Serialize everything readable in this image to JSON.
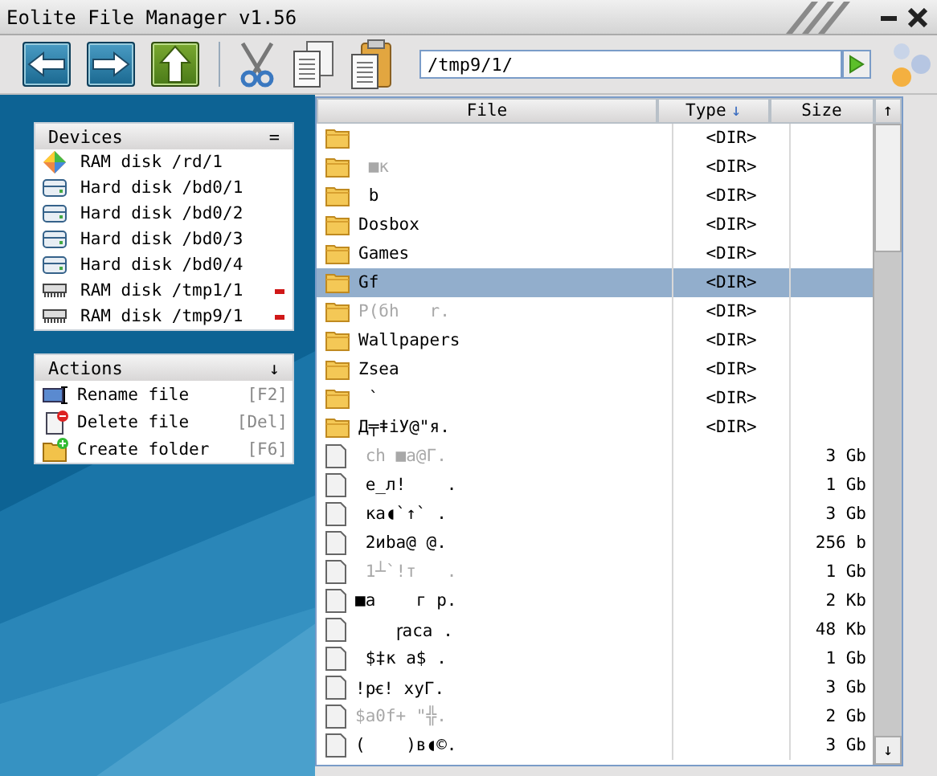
{
  "window": {
    "title": "Eolite File Manager v1.56"
  },
  "toolbar": {
    "path": "/tmp9/1/"
  },
  "devices": {
    "title": "Devices",
    "menu": "=",
    "items": [
      {
        "kind": "ramdisk",
        "label": "RAM disk /rd/1",
        "removable": false
      },
      {
        "kind": "hdd",
        "label": "Hard disk /bd0/1",
        "removable": false
      },
      {
        "kind": "hdd",
        "label": "Hard disk /bd0/2",
        "removable": false
      },
      {
        "kind": "hdd",
        "label": "Hard disk /bd0/3",
        "removable": false
      },
      {
        "kind": "hdd",
        "label": "Hard disk /bd0/4",
        "removable": false
      },
      {
        "kind": "tmpdisk",
        "label": "RAM disk /tmp1/1",
        "removable": true
      },
      {
        "kind": "tmpdisk",
        "label": "RAM disk /tmp9/1",
        "removable": true
      }
    ]
  },
  "actions": {
    "title": "Actions",
    "menu": "↓",
    "items": [
      {
        "kind": "rename",
        "label": "Rename file",
        "shortcut": "[F2]"
      },
      {
        "kind": "delete",
        "label": "Delete file",
        "shortcut": "[Del]"
      },
      {
        "kind": "create",
        "label": "Create folder",
        "shortcut": "[F6]"
      }
    ]
  },
  "table": {
    "columns": [
      {
        "label": "File"
      },
      {
        "label": "Type",
        "sort_arrow": "↓"
      },
      {
        "label": "Size"
      }
    ],
    "scroll_up": "↑",
    "scroll_down": "↓",
    "rows": [
      {
        "kind": "dir",
        "type": "<DIR>",
        "selected": false
      },
      {
        "kind": "dir",
        "name": " ■к",
        "type": "<DIR>",
        "dimmed": true,
        "selected": false
      },
      {
        "kind": "dir",
        "name": " b",
        "type": "<DIR>",
        "dimmed": false,
        "selected": false
      },
      {
        "kind": "dir",
        "name": "Dosbox",
        "type": "<DIR>",
        "dimmed": false,
        "selected": false
      },
      {
        "kind": "dir",
        "name": "Games",
        "type": "<DIR>",
        "dimmed": false,
        "selected": false
      },
      {
        "kind": "dir",
        "name": "Gf",
        "type": "<DIR>",
        "dimmed": false,
        "selected": true
      },
      {
        "kind": "dir",
        "name": "P(бh   r.",
        "type": "<DIR>",
        "dimmed": true,
        "selected": false
      },
      {
        "kind": "dir",
        "name": "Wallpapers",
        "type": "<DIR>",
        "dimmed": false,
        "selected": false
      },
      {
        "kind": "dir",
        "name": "Zsea",
        "type": "<DIR>",
        "dimmed": false,
        "selected": false
      },
      {
        "kind": "dir",
        "name": " `",
        "type": "<DIR>",
        "dimmed": false,
        "selected": false
      },
      {
        "kind": "dir",
        "name": "Д╤ǂiУ@\"я.",
        "type": "<DIR>",
        "dimmed": false,
        "selected": false
      },
      {
        "kind": "file",
        "name": " ch ■a@Г.",
        "size": "3 Gb",
        "dimmed": true,
        "selected": false
      },
      {
        "kind": "file",
        "name": " e_л!    .",
        "size": "1 Gb",
        "dimmed": false,
        "selected": false
      },
      {
        "kind": "file",
        "name": " ка◖`↑` .",
        "size": "3 Gb",
        "dimmed": false,
        "selected": false
      },
      {
        "kind": "file",
        "name": " 2иba@ @.",
        "size": "256 b",
        "dimmed": false,
        "selected": false
      },
      {
        "kind": "file",
        "name": " 1┴`!т   .",
        "size": "1 Gb",
        "dimmed": true,
        "selected": false
      },
      {
        "kind": "file",
        "name": "■a    г р.",
        "size": "2 Kb",
        "dimmed": false,
        "selected": false
      },
      {
        "kind": "file",
        "name": "    ꞅaca .",
        "size": "48 Kb",
        "dimmed": false,
        "selected": false
      },
      {
        "kind": "file",
        "name": " $‡к a$ .",
        "size": "1 Gb",
        "dimmed": false,
        "selected": false
      },
      {
        "kind": "file",
        "name": "!pꞓ! xyГ.",
        "size": "3 Gb",
        "dimmed": false,
        "selected": false
      },
      {
        "kind": "file",
        "name": "$a0f+ \"╬.",
        "size": "2 Gb",
        "dimmed": true,
        "selected": false
      },
      {
        "kind": "file",
        "name": "(    )в◖©.",
        "size": "3 Gb",
        "dimmed": false,
        "selected": false
      }
    ]
  }
}
